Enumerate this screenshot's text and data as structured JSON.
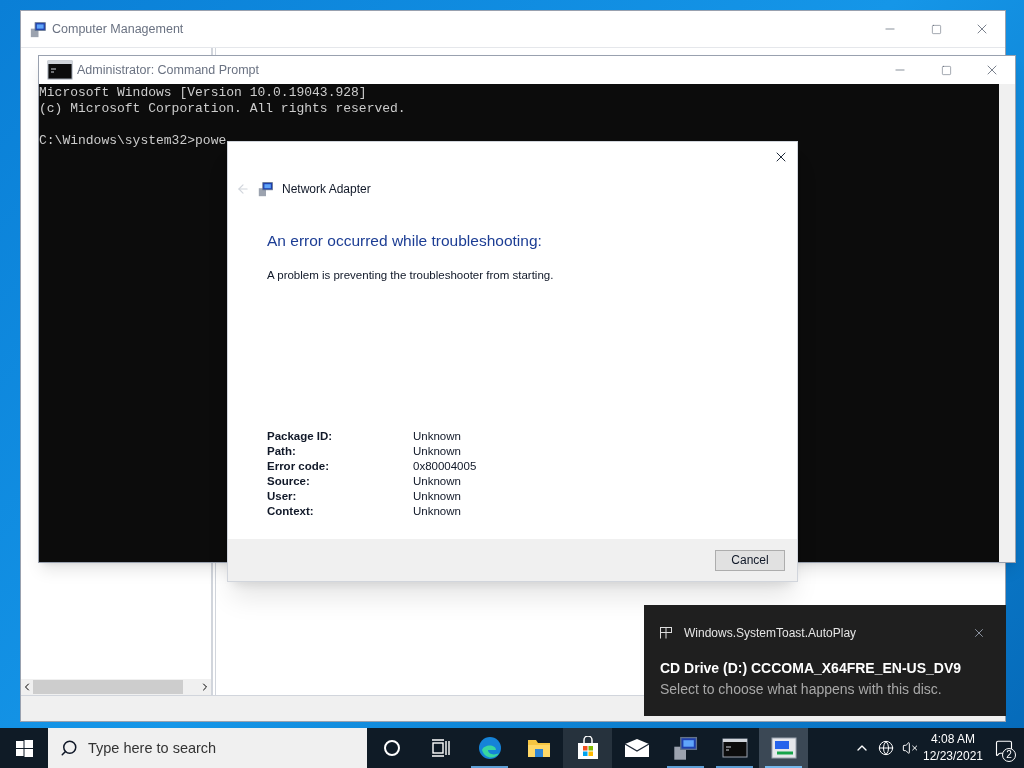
{
  "computer_management": {
    "title": "Computer Management"
  },
  "command_prompt": {
    "title": "Administrator: Command Prompt",
    "lines": [
      "Microsoft Windows [Version 10.0.19043.928]",
      "(c) Microsoft Corporation. All rights reserved."
    ],
    "prompt": "C:\\Windows\\system32>powe"
  },
  "dialog": {
    "title": "Network Adapter",
    "heading": "An error occurred while troubleshooting:",
    "message": "A problem is preventing the troubleshooter from starting.",
    "details": [
      {
        "label": "Package ID:",
        "value": "Unknown"
      },
      {
        "label": "Path:",
        "value": "Unknown"
      },
      {
        "label": "Error code:",
        "value": "0x80004005"
      },
      {
        "label": "Source:",
        "value": "Unknown"
      },
      {
        "label": "User:",
        "value": "Unknown"
      },
      {
        "label": "Context:",
        "value": "Unknown"
      }
    ],
    "buttons": [
      "Cancel"
    ]
  },
  "toast": {
    "app": "Windows.SystemToast.AutoPlay",
    "title": "CD Drive (D:) CCCOMA_X64FRE_EN-US_DV9",
    "message": "Select to choose what happens with this disc."
  },
  "taskbar": {
    "search": {
      "placeholder": "Type here to search"
    },
    "apps": [
      {
        "kind": "cortana",
        "running": false,
        "hovered": false,
        "selected": false
      },
      {
        "kind": "task-view",
        "running": false,
        "hovered": false,
        "selected": false
      },
      {
        "kind": "edge",
        "running": true,
        "hovered": false,
        "selected": false
      },
      {
        "kind": "explorer",
        "running": false,
        "hovered": false,
        "selected": false
      },
      {
        "kind": "store",
        "running": false,
        "hovered": true,
        "selected": false
      },
      {
        "kind": "mail",
        "running": false,
        "hovered": false,
        "selected": false
      },
      {
        "kind": "computer-management",
        "running": true,
        "hovered": false,
        "selected": false
      },
      {
        "kind": "command-prompt",
        "running": true,
        "hovered": false,
        "selected": false
      },
      {
        "kind": "troubleshooter",
        "running": true,
        "hovered": false,
        "selected": true
      }
    ],
    "clock": {
      "time": "4:08 AM",
      "date": "12/23/2021"
    },
    "notifications": {
      "count": "2"
    }
  }
}
